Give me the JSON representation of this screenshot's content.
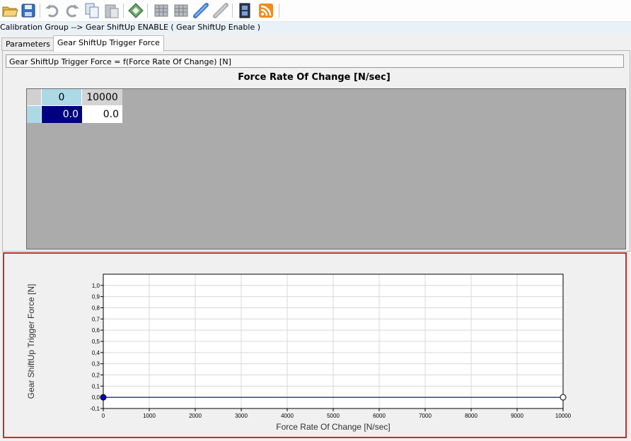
{
  "toolbar": {
    "icons": [
      "folder-open-icon",
      "save-icon",
      "undo-icon",
      "redo-icon",
      "copy-icon",
      "paste-icon",
      "diamond-icon",
      "grid-icon",
      "grid-alt-icon",
      "link-icon",
      "link-disabled-icon",
      "film-icon",
      "rss-icon"
    ]
  },
  "breadcrumb": "Calibration Group --> Gear ShiftUp ENABLE ( Gear ShiftUp Enable )",
  "tabs": [
    "Parameters",
    "Gear ShiftUp Trigger Force"
  ],
  "active_tab": 1,
  "formula": "Gear ShiftUp Trigger Force = f(Force Rate Of Change)  [N]",
  "table": {
    "axis_title": "Force Rate Of Change  [N/sec]",
    "x_headers": [
      "0",
      "10000"
    ],
    "values": [
      "0.0",
      "0.0"
    ]
  },
  "colors": {
    "header_blue": "#add8e6",
    "selected_cell": "#000080",
    "chart_line": "#000080",
    "panel_border": "#c03030"
  },
  "chart_data": {
    "type": "line",
    "xlabel": "Force Rate Of Change  [N/sec]",
    "ylabel": "Gear ShiftUp Trigger Force  [N]",
    "x": [
      0,
      10000
    ],
    "series": [
      {
        "values": [
          0.0,
          0.0
        ]
      }
    ],
    "xlim": [
      0,
      10000
    ],
    "ylim": [
      -0.1,
      1.1
    ],
    "xticks": [
      "0",
      "1000",
      "2000",
      "3000",
      "4000",
      "5000",
      "6000",
      "7000",
      "8000",
      "9000",
      "10000"
    ],
    "yticks": [
      "-0,1",
      "0,0",
      "0,1",
      "0,2",
      "0,3",
      "0,4",
      "0,5",
      "0,6",
      "0,7",
      "0,8",
      "0,9",
      "1,0"
    ],
    "grid": true
  }
}
